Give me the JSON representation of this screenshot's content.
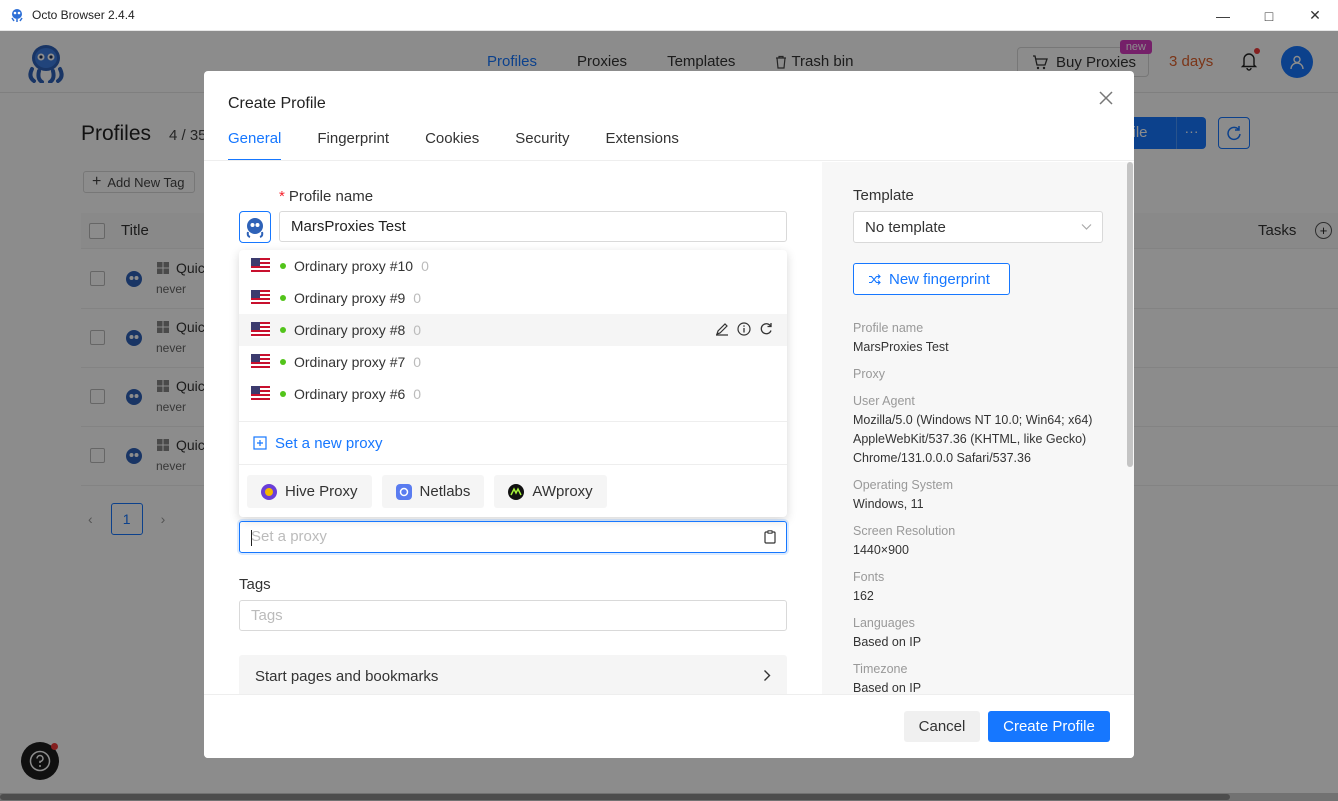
{
  "window": {
    "title": "Octo Browser 2.4.4"
  },
  "header": {
    "nav": [
      "Profiles",
      "Proxies",
      "Templates",
      "Trash bin"
    ],
    "buy_proxies": "Buy Proxies",
    "new_badge": "new",
    "days": "3 days"
  },
  "page": {
    "title": "Profiles",
    "count": "4 / 35",
    "add_tag": "Add New Tag",
    "col_title": "Title",
    "col_tasks": "Tasks",
    "create_btn_partial": "ofile",
    "rows": [
      {
        "name": "Quic",
        "sub": "never"
      },
      {
        "name": "Quic",
        "sub": "never"
      },
      {
        "name": "Quic",
        "sub": "never"
      },
      {
        "name": "Quic",
        "sub": "never"
      }
    ],
    "page_number": "1"
  },
  "modal": {
    "title": "Create Profile",
    "tabs": [
      "General",
      "Fingerprint",
      "Cookies",
      "Security",
      "Extensions"
    ],
    "profile_name_label": "Profile name",
    "profile_name_value": "MarsProxies Test",
    "proxies": [
      {
        "name": "Ordinary proxy #10",
        "count": "0"
      },
      {
        "name": "Ordinary proxy #9",
        "count": "0"
      },
      {
        "name": "Ordinary proxy #8",
        "count": "0"
      },
      {
        "name": "Ordinary proxy #7",
        "count": "0"
      },
      {
        "name": "Ordinary proxy #6",
        "count": "0"
      }
    ],
    "set_new_proxy": "Set a new proxy",
    "providers": [
      "Hive Proxy",
      "Netlabs",
      "AWproxy"
    ],
    "proxy_placeholder": "Set a proxy",
    "tags_label": "Tags",
    "tags_placeholder": "Tags",
    "start_pages": "Start pages and bookmarks",
    "template_label": "Template",
    "template_value": "No template",
    "new_fingerprint": "New fingerprint",
    "info": {
      "profile_name_k": "Profile name",
      "profile_name_v": "MarsProxies Test",
      "proxy_k": "Proxy",
      "ua_k": "User Agent",
      "ua_v1": "Mozilla/5.0 (Windows NT 10.0; Win64; x64)",
      "ua_v2": "AppleWebKit/537.36 (KHTML, like Gecko)",
      "ua_v3": "Chrome/131.0.0.0 Safari/537.36",
      "os_k": "Operating System",
      "os_v": "Windows, 11",
      "res_k": "Screen Resolution",
      "res_v": "1440×900",
      "fonts_k": "Fonts",
      "fonts_v": "162",
      "lang_k": "Languages",
      "lang_v": "Based on IP",
      "tz_k": "Timezone",
      "tz_v": "Based on IP"
    },
    "cancel": "Cancel",
    "create": "Create Profile"
  },
  "colors": {
    "accent": "#1677ff",
    "days": "#e0622c",
    "badge": "#d63bc0",
    "online": "#52c41a"
  }
}
